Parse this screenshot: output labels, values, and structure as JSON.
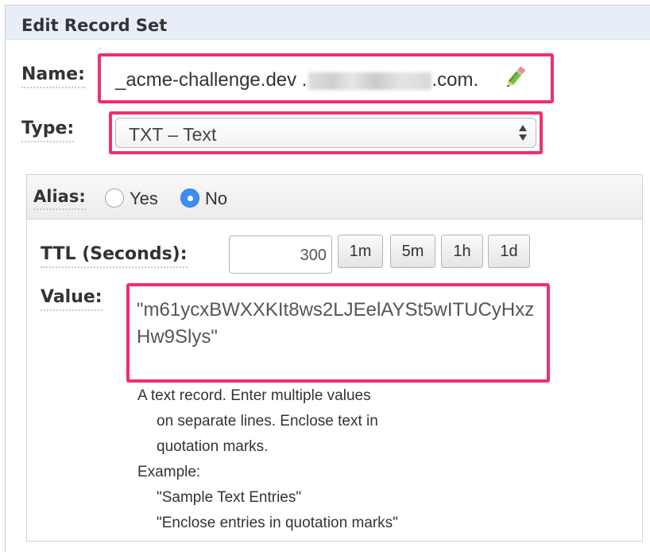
{
  "panel": {
    "title": "Edit Record Set"
  },
  "name": {
    "label": "Name:",
    "value_prefix": "_acme-challenge.dev .",
    "value_suffix": ".com.",
    "edit_icon": "pencil-icon"
  },
  "type": {
    "label": "Type:",
    "selected": "TXT – Text"
  },
  "alias": {
    "label": "Alias:",
    "options": [
      {
        "label": "Yes",
        "checked": false
      },
      {
        "label": "No",
        "checked": true
      }
    ]
  },
  "ttl": {
    "label": "TTL (Seconds):",
    "value": "300",
    "presets": [
      "1m",
      "5m",
      "1h",
      "1d"
    ]
  },
  "value": {
    "label": "Value:",
    "text": "\"m61ycxBWXXKIt8ws2LJEelAYSt5wITUCyHxzHw9Slys\""
  },
  "help": {
    "line1": "A text record. Enter multiple values",
    "line2": "on separate lines. Enclose text in",
    "line3": "quotation marks.",
    "example_label": "Example:",
    "example1": "\"Sample Text Entries\"",
    "example2": "\"Enclose entries in quotation marks\""
  },
  "colors": {
    "highlight": "#ef2f6f",
    "header_bg": "#e8eef8",
    "radio_checked": "#3d8df4"
  }
}
